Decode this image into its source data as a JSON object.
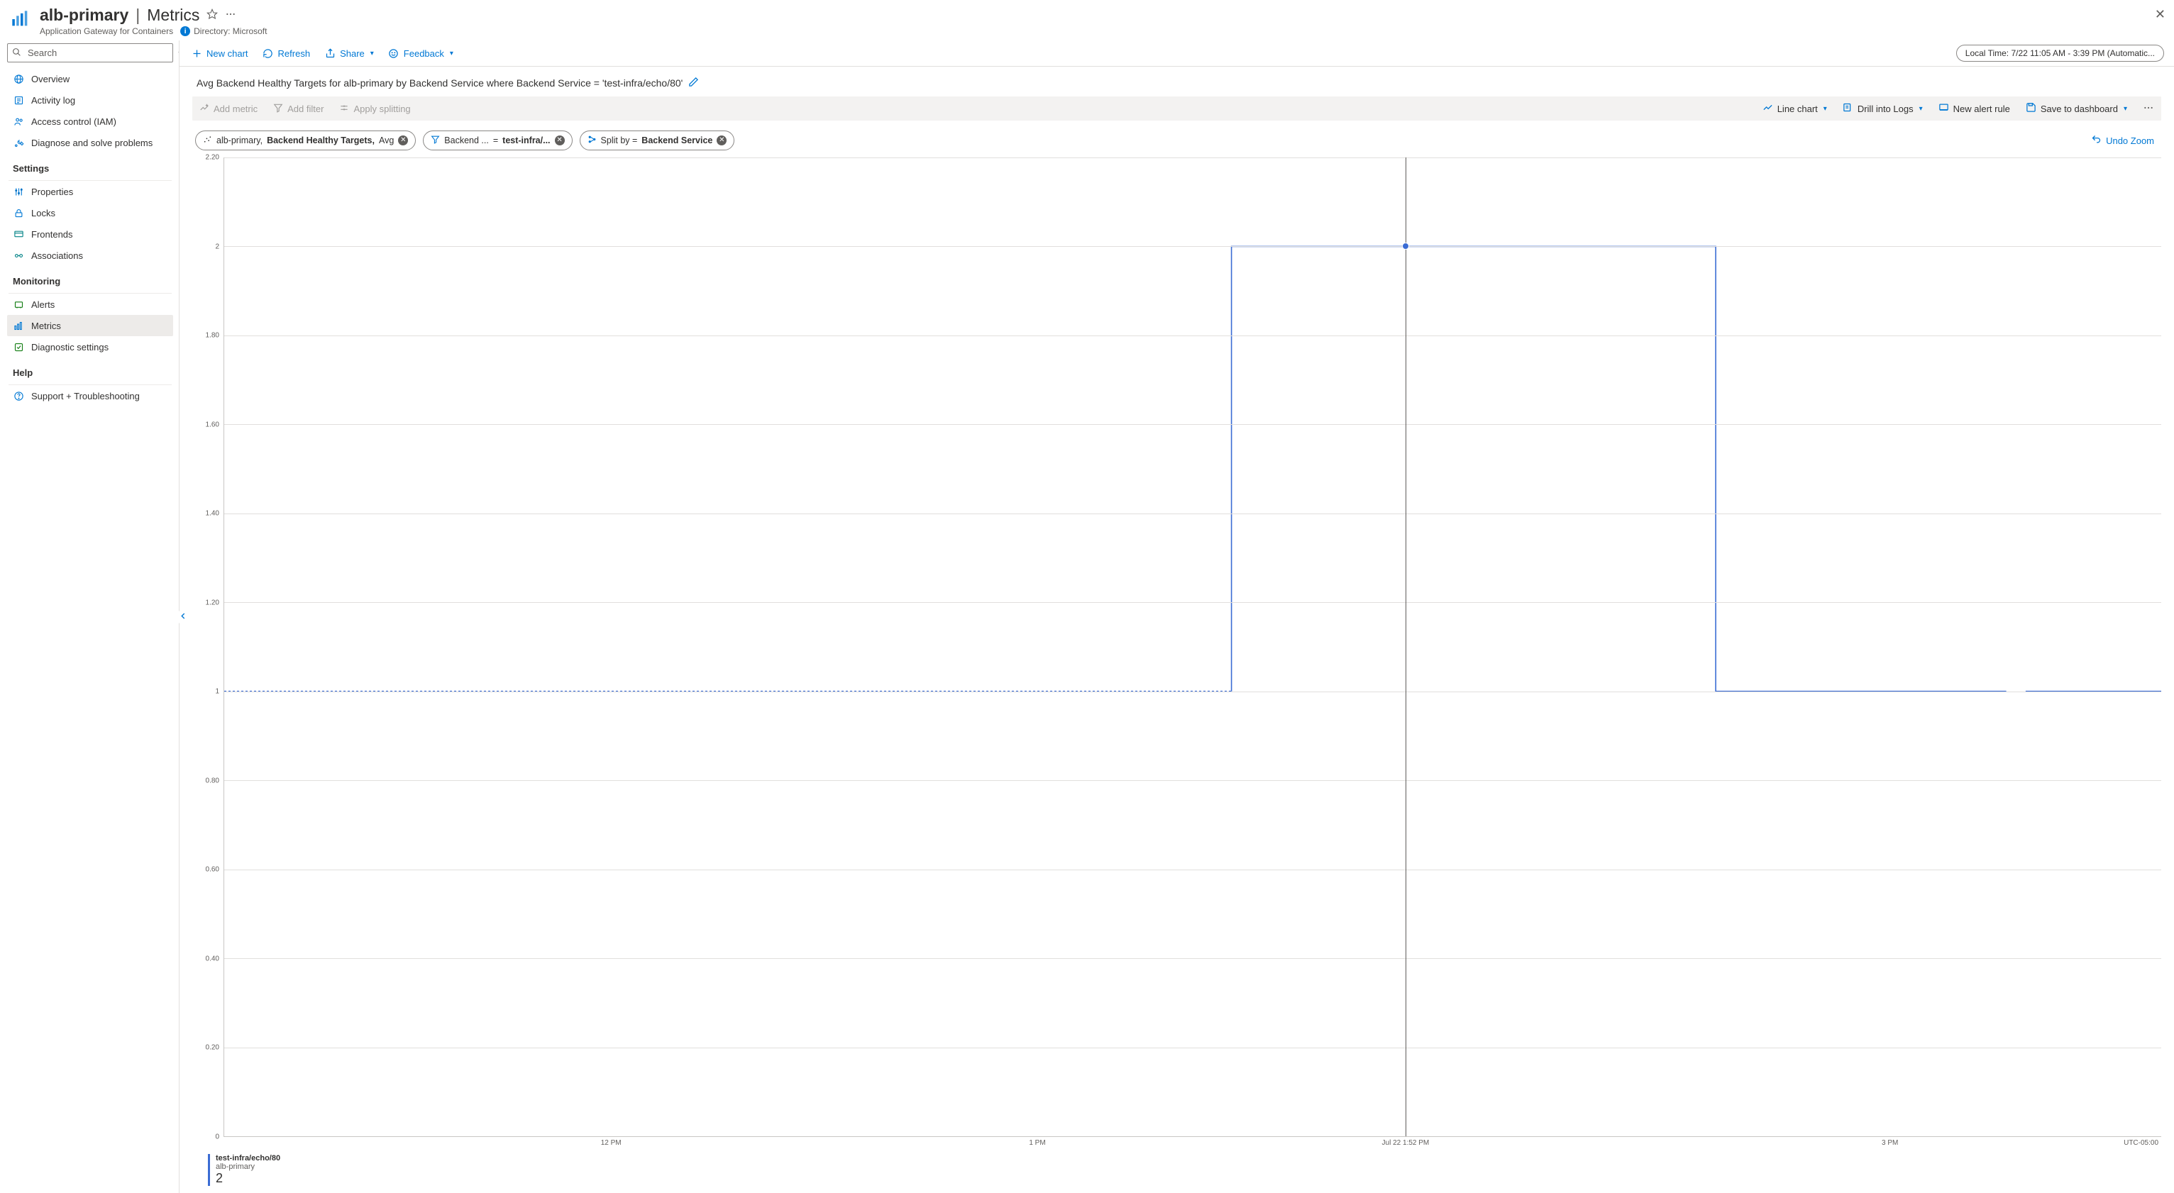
{
  "header": {
    "resource_name": "alb-primary",
    "section": "Metrics",
    "subtitle": "Application Gateway for Containers",
    "directory_label": "Directory: Microsoft"
  },
  "search": {
    "placeholder": "Search"
  },
  "sidebar": {
    "items_top": [
      {
        "label": "Overview",
        "icon": "globe"
      },
      {
        "label": "Activity log",
        "icon": "log"
      },
      {
        "label": "Access control (IAM)",
        "icon": "people"
      },
      {
        "label": "Diagnose and solve problems",
        "icon": "wrench"
      }
    ],
    "group_settings": "Settings",
    "items_settings": [
      {
        "label": "Properties",
        "icon": "props"
      },
      {
        "label": "Locks",
        "icon": "lock"
      },
      {
        "label": "Frontends",
        "icon": "frontend"
      },
      {
        "label": "Associations",
        "icon": "assoc"
      }
    ],
    "group_monitoring": "Monitoring",
    "items_monitoring": [
      {
        "label": "Alerts",
        "icon": "alerts"
      },
      {
        "label": "Metrics",
        "icon": "metrics",
        "selected": true
      },
      {
        "label": "Diagnostic settings",
        "icon": "diag"
      }
    ],
    "group_help": "Help",
    "items_help": [
      {
        "label": "Support + Troubleshooting",
        "icon": "help"
      }
    ]
  },
  "toolbar": {
    "new_chart": "New chart",
    "refresh": "Refresh",
    "share": "Share",
    "feedback": "Feedback",
    "time_label": "Local Time: 7/22 11:05 AM - 3:39 PM (Automatic..."
  },
  "chart": {
    "title": "Avg Backend Healthy Targets for alb-primary by Backend Service where Backend Service = 'test-infra/echo/80'",
    "add_metric": "Add metric",
    "add_filter": "Add filter",
    "apply_splitting": "Apply splitting",
    "chart_type": "Line chart",
    "drill_logs": "Drill into Logs",
    "new_alert": "New alert rule",
    "save_dashboard": "Save to dashboard",
    "pill_metric_res": "alb-primary, ",
    "pill_metric_name": "Backend Healthy Targets, ",
    "pill_metric_agg": "Avg",
    "pill_filter_field": "Backend ...",
    "pill_filter_eq": "=",
    "pill_filter_value": "test-infra/...",
    "pill_split_label": "Split by = ",
    "pill_split_value": "Backend Service",
    "undo_zoom": "Undo Zoom",
    "legend_series": "test-infra/echo/80",
    "legend_resource": "alb-primary",
    "legend_value": "2",
    "utc": "UTC-05:00",
    "hover_time": "Jul 22 1:52 PM"
  },
  "chart_data": {
    "type": "line",
    "title": "Avg Backend Healthy Targets for alb-primary by Backend Service where Backend Service = 'test-infra/echo/80'",
    "xlabel": "",
    "ylabel": "",
    "ylim": [
      0,
      2.2
    ],
    "y_ticks": [
      "2.20",
      "2",
      "1.80",
      "1.60",
      "1.40",
      "1.20",
      "1",
      "0.80",
      "0.60",
      "0.40",
      "0.20",
      "0"
    ],
    "y_tick_values": [
      2.2,
      2.0,
      1.8,
      1.6,
      1.4,
      1.2,
      1.0,
      0.8,
      0.6,
      0.4,
      0.2,
      0
    ],
    "x_ticks": [
      {
        "label": "12 PM",
        "pos_pct": 20
      },
      {
        "label": "1 PM",
        "pos_pct": 42
      },
      {
        "label": "Jul 22 1:52 PM",
        "pos_pct": 61
      },
      {
        "label": "3 PM",
        "pos_pct": 86
      }
    ],
    "hover": {
      "x_pct": 61,
      "y_value": 2.0
    },
    "series": [
      {
        "name": "test-infra/echo/80",
        "resource": "alb-primary",
        "color": "#3b6cd4",
        "points": [
          {
            "x_pct": 0,
            "y": 1.0,
            "dashed": true
          },
          {
            "x_pct": 52,
            "y": 1.0,
            "dashed": true
          },
          {
            "x_pct": 52,
            "y": 1.0
          },
          {
            "x_pct": 52,
            "y": 2.0
          },
          {
            "x_pct": 77,
            "y": 2.0
          },
          {
            "x_pct": 77,
            "y": 1.0
          },
          {
            "x_pct": 90,
            "y": 1.0
          },
          {
            "x_pct": 92,
            "y": 1.0,
            "gap_after": true
          },
          {
            "x_pct": 93,
            "y": 1.0
          },
          {
            "x_pct": 100,
            "y": 1.0
          }
        ]
      }
    ]
  }
}
